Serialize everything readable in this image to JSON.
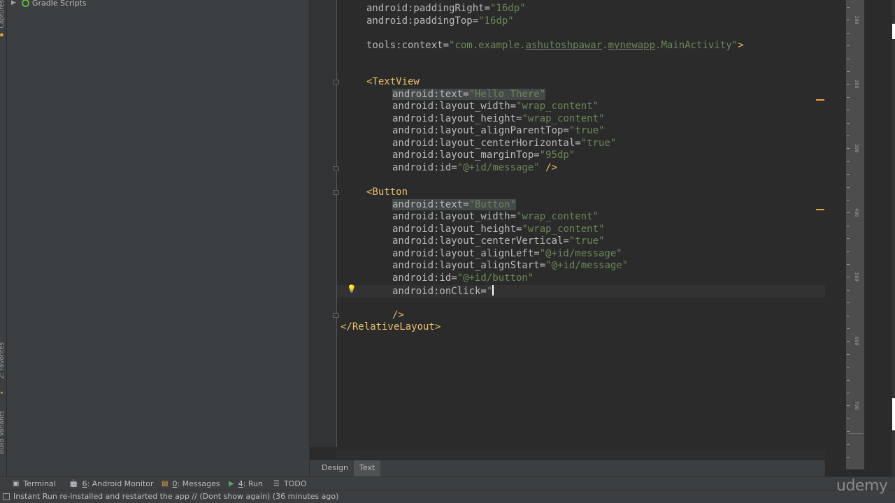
{
  "colors": {
    "tag": "#e8bf6a",
    "attr": "#bababa",
    "value": "#6a8759",
    "marker": "#e8a33d"
  },
  "left_strip": {
    "top_label": "Captures",
    "mid_label": "2: Favorites",
    "bottom_label": "Build Variants"
  },
  "project": {
    "gradle_label": "Gradle Scripts"
  },
  "code": {
    "l1_attr": "android:paddingRight=",
    "l1_val": "\"16dp\"",
    "l2_attr": "android:paddingTop=",
    "l2_val": "\"16dp\"",
    "l3_attr": "tools:context=",
    "l3_val_pre": "\"com.example.",
    "l3_val_ul1": "ashutoshpawar",
    "l3_val_dot": ".",
    "l3_val_ul2": "mynewapp",
    "l3_val_post": ".MainActivity\"",
    "l3_close": ">",
    "l4_tag": "<TextView",
    "l5_attr": "android:text=",
    "l5_val": "\"Hello There\"",
    "l6_attr": "android:layout_width=",
    "l6_val": "\"wrap_content\"",
    "l7_attr": "android:layout_height=",
    "l7_val": "\"wrap_content\"",
    "l8_attr": "android:layout_alignParentTop=",
    "l8_val": "\"true\"",
    "l9_attr": "android:layout_centerHorizontal=",
    "l9_val": "\"true\"",
    "l10_attr": "android:layout_marginTop=",
    "l10_val": "\"95dp\"",
    "l11_attr": "android:id=",
    "l11_val": "\"@+id/message\"",
    "l11_close": " />",
    "l12_tag": "<Button",
    "l13_attr": "android:text=",
    "l13_val": "\"Button\"",
    "l14_attr": "android:layout_width=",
    "l14_val": "\"wrap_content\"",
    "l15_attr": "android:layout_height=",
    "l15_val": "\"wrap_content\"",
    "l16_attr": "android:layout_centerVertical=",
    "l16_val": "\"true\"",
    "l17_attr": "android:layout_alignLeft=",
    "l17_val": "\"@+id/message\"",
    "l18_attr": "android:layout_alignStart=",
    "l18_val": "\"@+id/message\"",
    "l19_attr": "android:id=",
    "l19_val": "\"@+id/button\"",
    "l20_attr": "android:onClick=",
    "l20_val": "\"",
    "l21_close": "/>",
    "l22_tag": "</RelativeLayout>"
  },
  "editor_tabs": {
    "design": "Design",
    "text": "Text",
    "active": "Text"
  },
  "ruler": {
    "labels": [
      "100",
      "200",
      "300",
      "400",
      "500",
      "600",
      "700"
    ]
  },
  "bottom_toolbar": [
    {
      "label": "Terminal",
      "number": "",
      "icon": "terminal-icon"
    },
    {
      "label": ": Android Monitor",
      "number": "6",
      "icon": "android-icon"
    },
    {
      "label": ": Messages",
      "number": "0",
      "icon": "messages-icon"
    },
    {
      "label": ": Run",
      "number": "4",
      "icon": "run-icon"
    },
    {
      "label": "TODO",
      "number": "",
      "icon": "todo-icon"
    }
  ],
  "status": {
    "text": "Instant Run re-installed and restarted the app // (Dont show again) (36 minutes ago)"
  },
  "watermark": "udemy"
}
